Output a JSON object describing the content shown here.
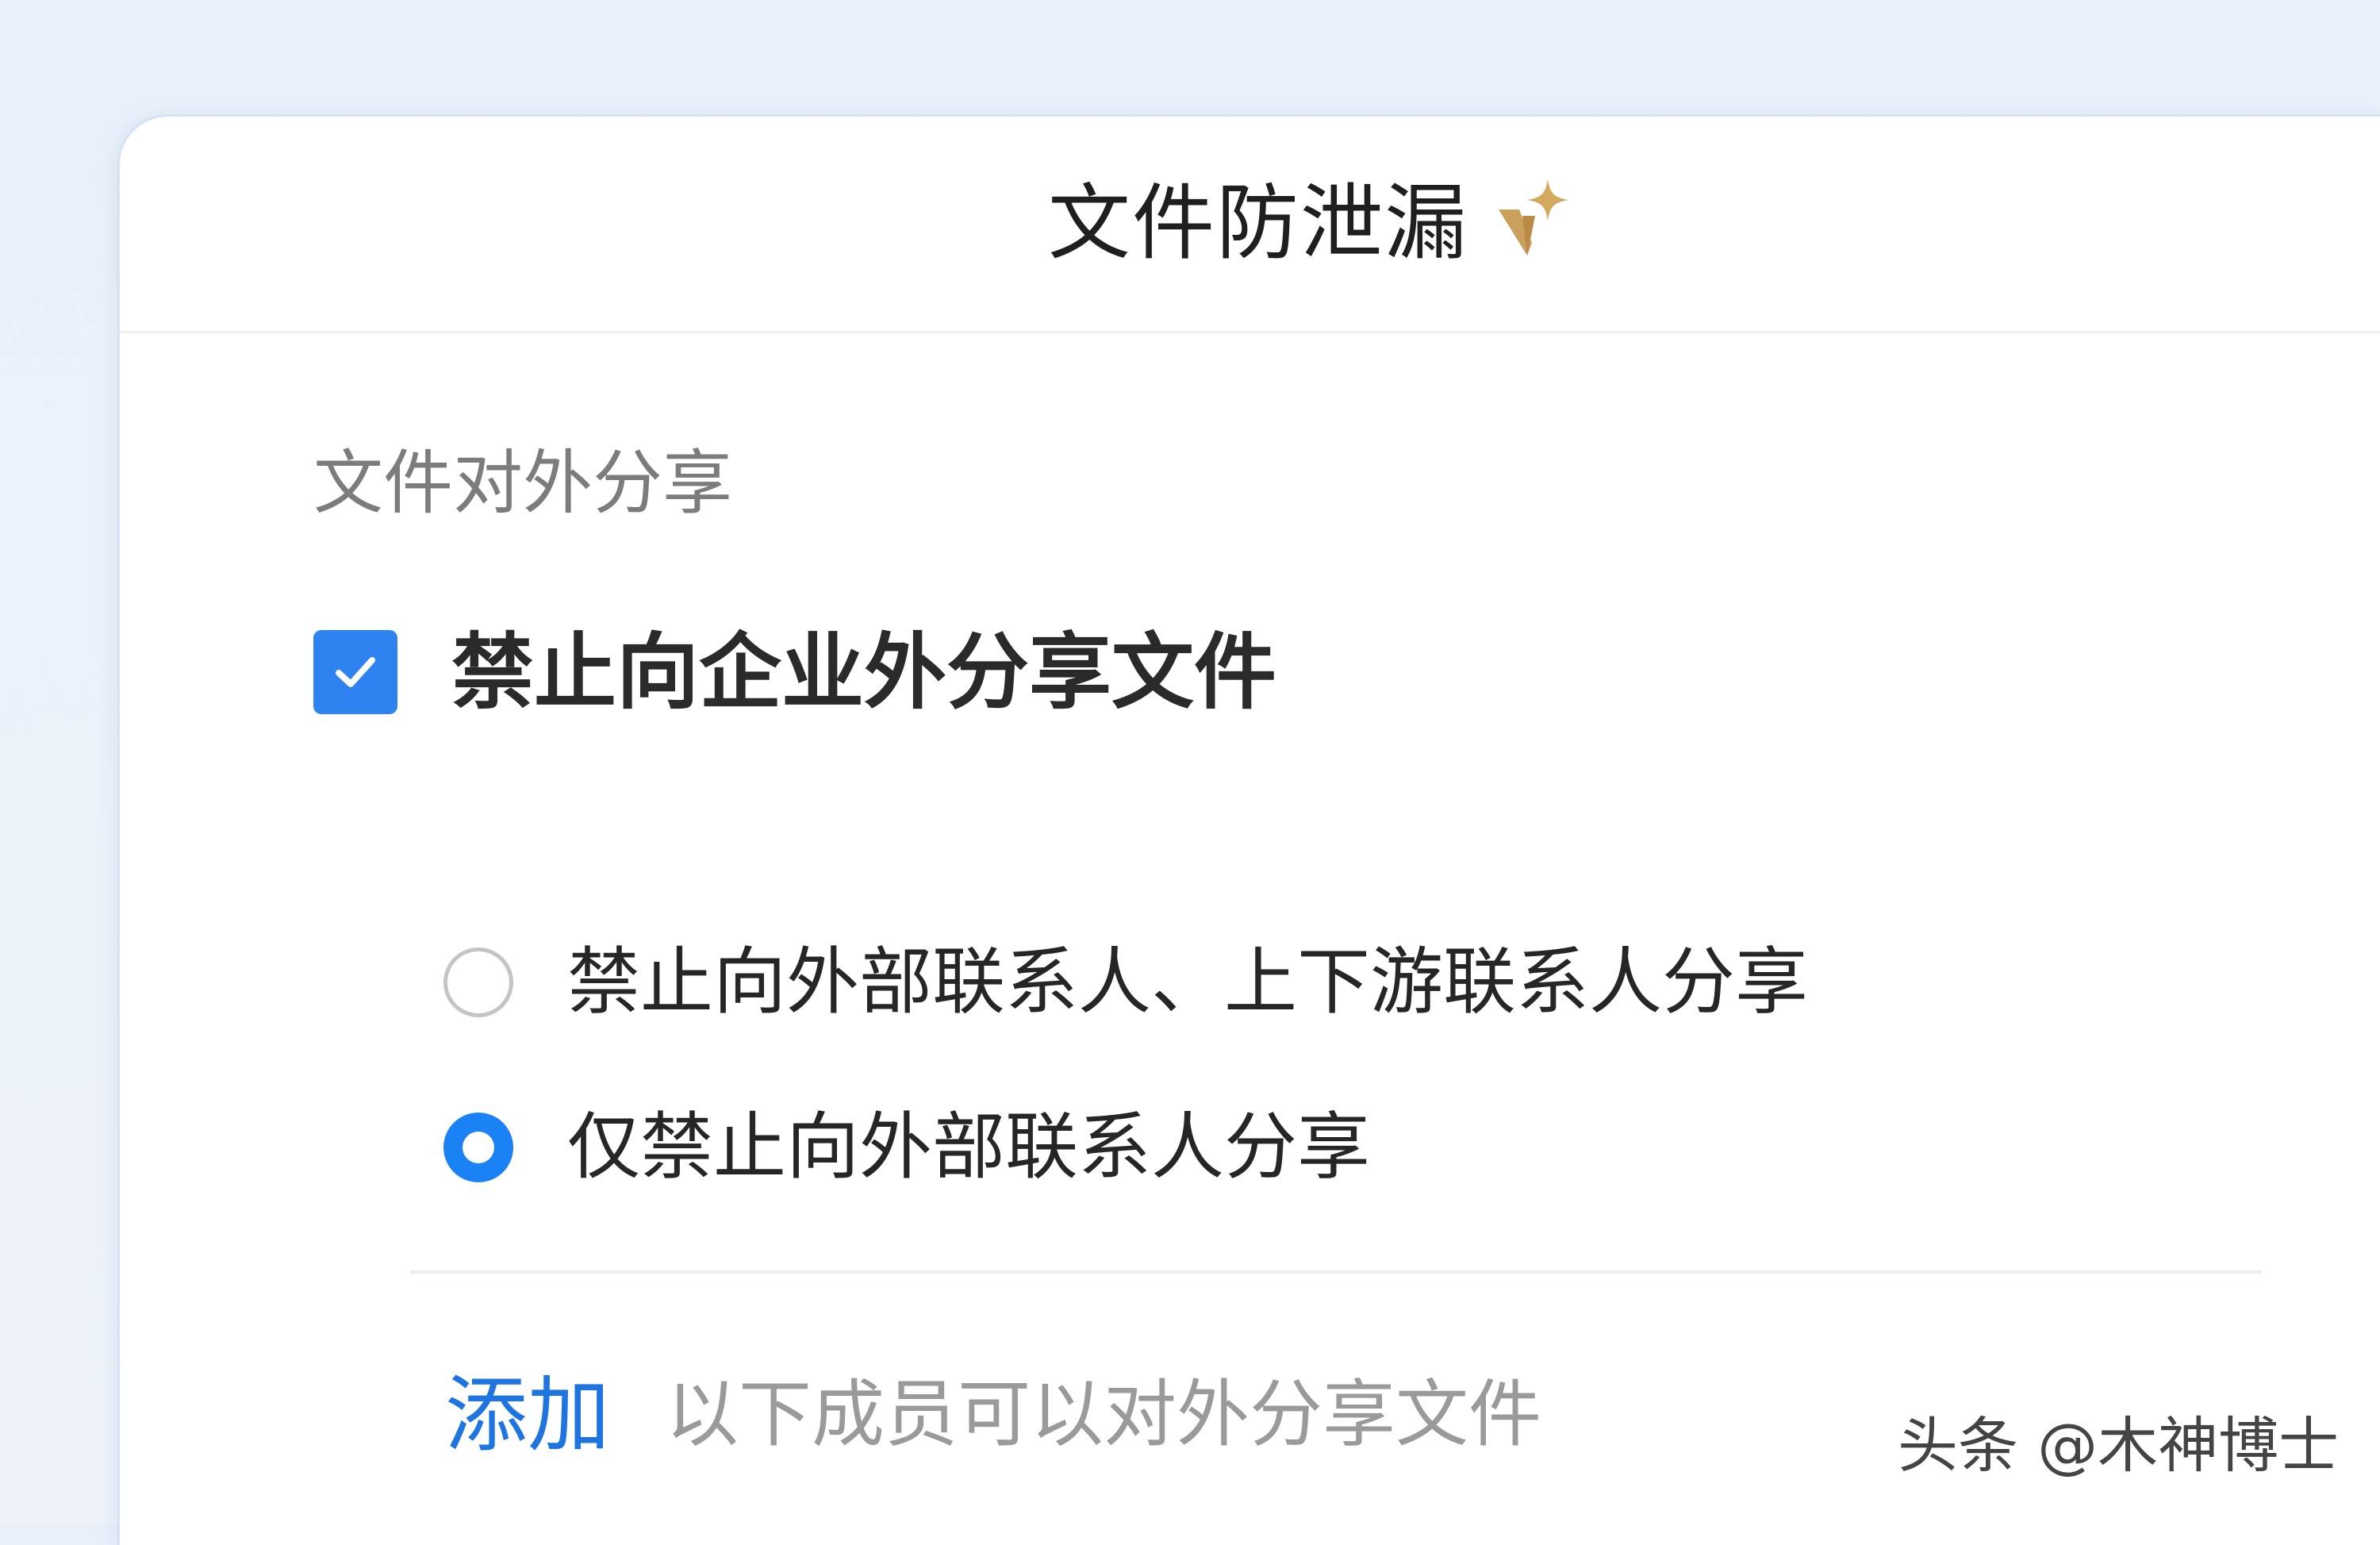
{
  "header": {
    "title": "文件防泄漏",
    "badge_icon": "sparkle-v-icon",
    "badge_color": "#c9a15c"
  },
  "section": {
    "label": "文件对外分享"
  },
  "block_external_share": {
    "label": "禁止向企业外分享文件",
    "checked": true,
    "accent_color": "#2f83f0"
  },
  "scope_options": [
    {
      "label": "禁止向外部联系人、上下游联系人分享",
      "selected": false
    },
    {
      "label": "仅禁止向外部联系人分享",
      "selected": true
    }
  ],
  "allow_list": {
    "add_label": "添加",
    "description": "以下成员可以对外分享文件",
    "link_color": "#1f75e0"
  },
  "watermark": {
    "text": "头条 @木神博士"
  }
}
